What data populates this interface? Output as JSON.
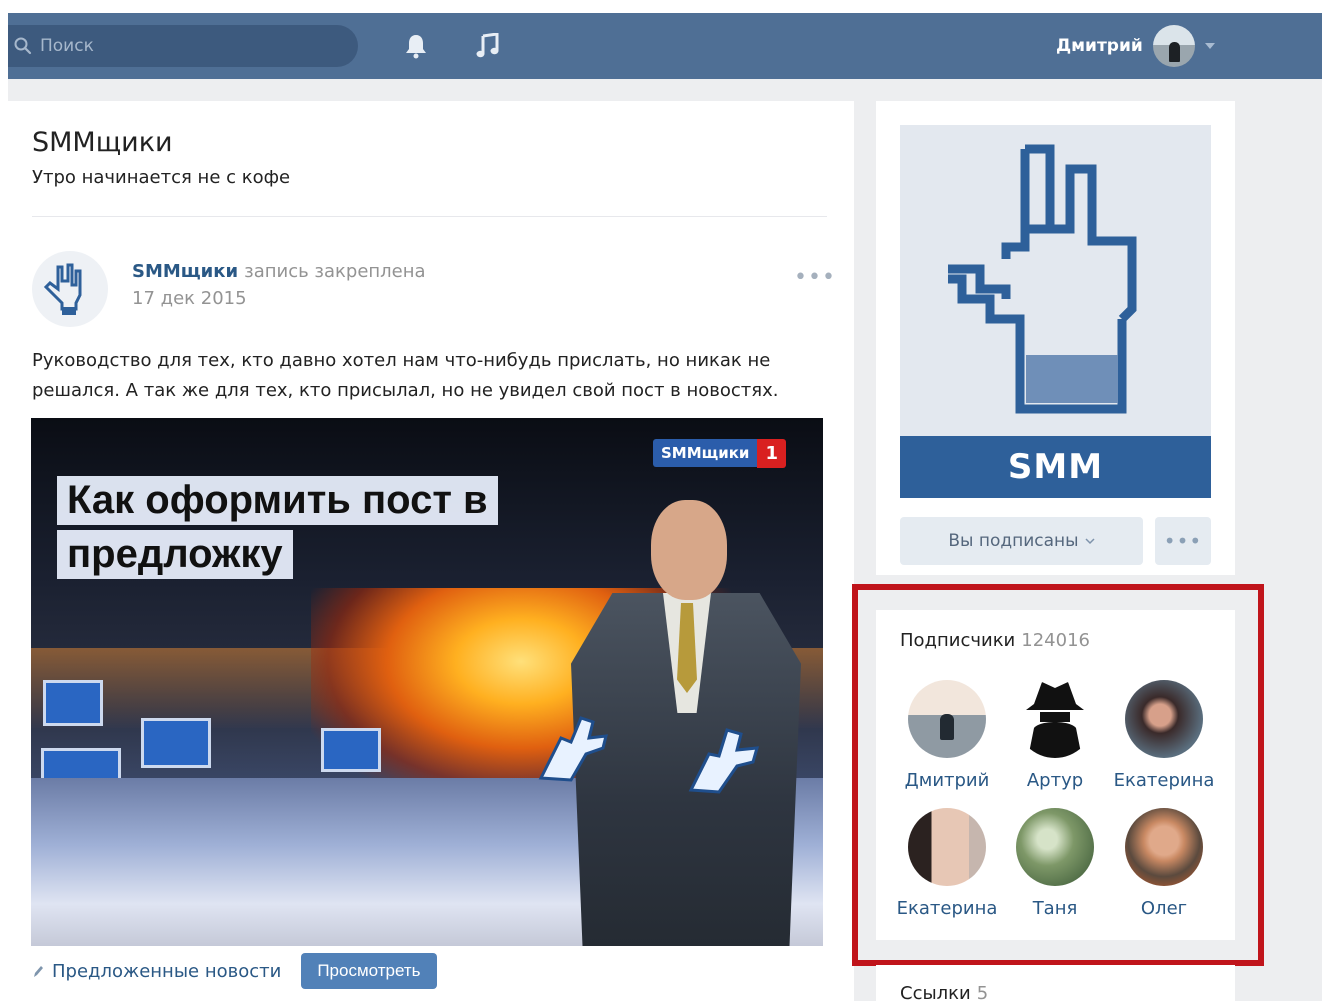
{
  "topbar": {
    "search_placeholder": "Поиск",
    "user_name": "Дмитрий",
    "icons": [
      "bell-icon",
      "music-icon"
    ]
  },
  "group": {
    "name": "SMMщики",
    "status": "Утро начинается не с кофе"
  },
  "post": {
    "author": "SMMщики",
    "pinned_label": "запись закреплена",
    "date": "17 дек 2015",
    "more": "•••",
    "text": "Руководство для тех, кто давно хотел нам что-нибудь прислать, но никак не решался. А так же для тех, кто присылал, но не увидел свой пост в новостях.",
    "image": {
      "headline_line1": "Как оформить пост в",
      "headline_line2": "предложку",
      "channel_logo": "SMMщики",
      "channel_number": "1"
    },
    "footer": {
      "suggested_label": "Предложенные новости",
      "view_button": "Просмотреть"
    }
  },
  "sidebar": {
    "cover_label": "SMM",
    "subscribed_button": "Вы подписаны",
    "more_button": "•••",
    "followers": {
      "title": "Подписчики",
      "count": "124016",
      "items": [
        {
          "name": "Дмитрий"
        },
        {
          "name": "Артур"
        },
        {
          "name": "Екатерина"
        },
        {
          "name": "Екатерина"
        },
        {
          "name": "Таня"
        },
        {
          "name": "Олег"
        }
      ]
    },
    "links": {
      "title": "Ссылки",
      "count": "5"
    }
  },
  "colors": {
    "header": "#4f6f95",
    "link": "#2a5885",
    "accent_button": "#5181b8",
    "highlight_frame": "#c0141b"
  }
}
